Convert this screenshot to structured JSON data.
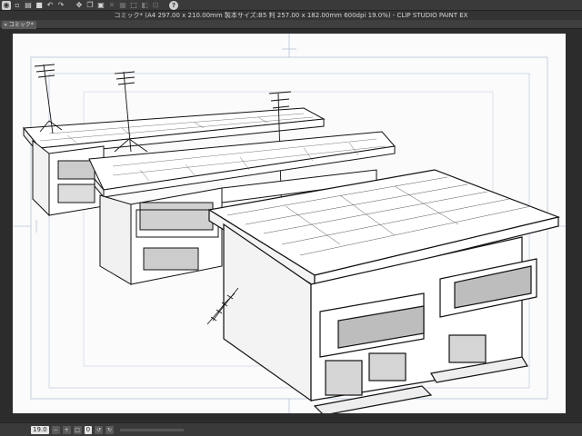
{
  "toolbar": {
    "icons": [
      "eye-icon",
      "new-file-icon",
      "open-file-icon",
      "save-icon",
      "undo-icon",
      "redo-icon",
      "transform-icon",
      "copy-icon",
      "paste-icon",
      "clear-icon",
      "fill-icon",
      "selection-icon",
      "invert-icon",
      "deselect-icon",
      "help-icon"
    ]
  },
  "window": {
    "title": "コミック* (A4 297.00 x 210.00mm 製本サイズ:B5 判 257.00 x 182.00mm 600dpi 19.0%)  - CLIP STUDIO PAINT EX"
  },
  "tabs": [
    {
      "label": "コミック*"
    }
  ],
  "statusbar": {
    "zoom": "19.0",
    "angle": "0"
  }
}
